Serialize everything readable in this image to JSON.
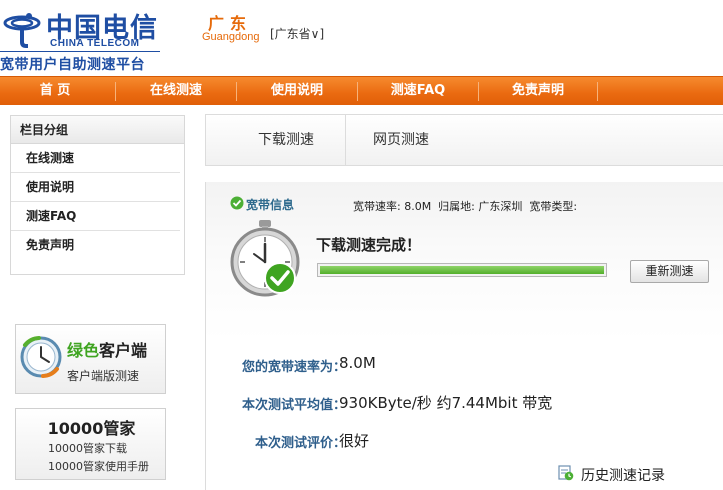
{
  "header": {
    "logo_cn": "中国电信",
    "logo_en": "CHINA TELECOM",
    "site_name": "宽带用户自助测速平台",
    "province_cn": "广东",
    "province_en": "Guangdong",
    "province_select": "[广东省∨]"
  },
  "nav": {
    "items": [
      "首 页",
      "在线测速",
      "使用说明",
      "测速FAQ",
      "免责声明"
    ]
  },
  "sidebar": {
    "heading": "栏目分组",
    "items": [
      "在线测速",
      "使用说明",
      "测速FAQ",
      "免责声明"
    ]
  },
  "promo_client": {
    "title_green": "绿色",
    "title_rest": "客户端",
    "subtitle": "客户端版测速"
  },
  "promo_manager": {
    "title": "10000管家",
    "line1": "10000管家下载",
    "line2": "10000管家使用手册"
  },
  "tabs": [
    "下载测速",
    "网页测速"
  ],
  "info": {
    "title": "宽带信息",
    "line": "宽带速率: 8.0M  归属地: 广东深圳  宽带类型:"
  },
  "status": {
    "message": "下载测速完成！",
    "progress_percent": 100,
    "retest_label": "重新测速"
  },
  "results": [
    {
      "label": "您的宽带速率为：",
      "value": "8.0M"
    },
    {
      "label": "本次测试平均值：",
      "value": "930KByte/秒 约7.44Mbit 带宽"
    },
    {
      "label": "本次测试评价：",
      "value": "很好"
    }
  ],
  "history_link": "历史测速记录",
  "colors": {
    "brand_blue": "#1f4ea3",
    "nav_orange": "#ea6a10",
    "label_blue": "#2f5f8c",
    "progress_green": "#53b02b"
  },
  "icons": [
    "china-telecom-logo-icon",
    "check-icon",
    "stopwatch-icon",
    "client-clock-icon",
    "history-icon"
  ]
}
